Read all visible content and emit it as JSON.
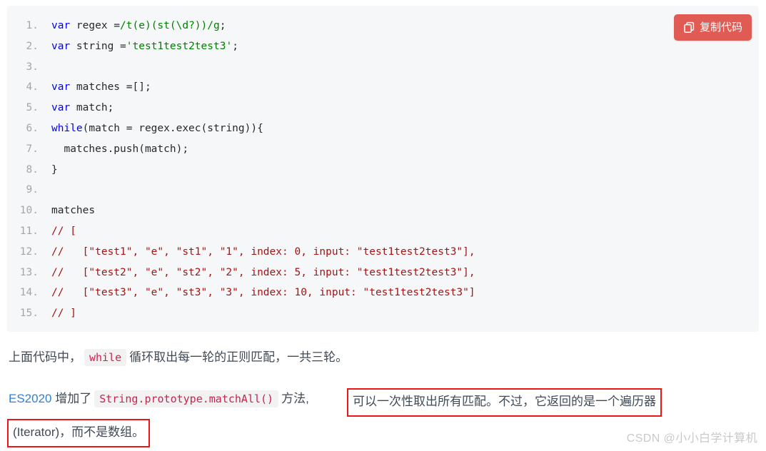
{
  "code_block": {
    "language": "javascript",
    "background_color": "#f6f7f8",
    "copy_button": {
      "label": "复制代码",
      "icon": "copy-icon",
      "color": "#e05b53"
    },
    "lines": [
      {
        "n": "1",
        "tokens": [
          {
            "t": "kw",
            "v": "var"
          },
          {
            "t": "pln",
            "v": " regex ="
          },
          {
            "t": "str",
            "v": "/t(e)(st(\\d?))/g"
          },
          {
            "t": "pln",
            "v": ";"
          }
        ]
      },
      {
        "n": "2",
        "tokens": [
          {
            "t": "kw",
            "v": "var"
          },
          {
            "t": "pln",
            "v": " string ="
          },
          {
            "t": "str",
            "v": "'test1test2test3'"
          },
          {
            "t": "pln",
            "v": ";"
          }
        ]
      },
      {
        "n": "3",
        "tokens": []
      },
      {
        "n": "4",
        "tokens": [
          {
            "t": "kw",
            "v": "var"
          },
          {
            "t": "pln",
            "v": " matches =[];"
          }
        ]
      },
      {
        "n": "5",
        "tokens": [
          {
            "t": "kw",
            "v": "var"
          },
          {
            "t": "pln",
            "v": " match;"
          }
        ]
      },
      {
        "n": "6",
        "tokens": [
          {
            "t": "kw",
            "v": "while"
          },
          {
            "t": "pln",
            "v": "(match = regex.exec(string)){"
          }
        ]
      },
      {
        "n": "7",
        "tokens": [
          {
            "t": "pln",
            "v": "  matches.push(match);"
          }
        ]
      },
      {
        "n": "8",
        "tokens": [
          {
            "t": "pln",
            "v": "}"
          }
        ]
      },
      {
        "n": "9",
        "tokens": []
      },
      {
        "n": "10",
        "tokens": [
          {
            "t": "pln",
            "v": "matches"
          }
        ]
      },
      {
        "n": "11",
        "tokens": [
          {
            "t": "cmt",
            "v": "// ["
          }
        ]
      },
      {
        "n": "12",
        "tokens": [
          {
            "t": "cmt",
            "v": "//   [\"test1\", \"e\", \"st1\", \"1\", index: 0, input: \"test1test2test3\"],"
          }
        ]
      },
      {
        "n": "13",
        "tokens": [
          {
            "t": "cmt",
            "v": "//   [\"test2\", \"e\", \"st2\", \"2\", index: 5, input: \"test1test2test3\"],"
          }
        ]
      },
      {
        "n": "14",
        "tokens": [
          {
            "t": "cmt",
            "v": "//   [\"test3\", \"e\", \"st3\", \"3\", index: 10, input: \"test1test2test3\"]"
          }
        ]
      },
      {
        "n": "15",
        "tokens": [
          {
            "t": "cmt",
            "v": "// ]"
          }
        ]
      }
    ]
  },
  "prose": {
    "para1_before": "上面代码中，",
    "para1_code": "while",
    "para1_after": "循环取出每一轮的正则匹配，一共三轮。",
    "para2_link": "ES2020",
    "para2_before": "增加了",
    "para2_code": "String.prototype.matchAll()",
    "para2_after": "方法,",
    "highlight1": "可以一次性取出所有匹配。不过，它返回的是一个遍历器",
    "highlight2": "(Iterator)，而不是数组。"
  },
  "annotation": {
    "box_color": "#f11616"
  },
  "watermark": {
    "text": "CSDN @小小白学计算机"
  }
}
